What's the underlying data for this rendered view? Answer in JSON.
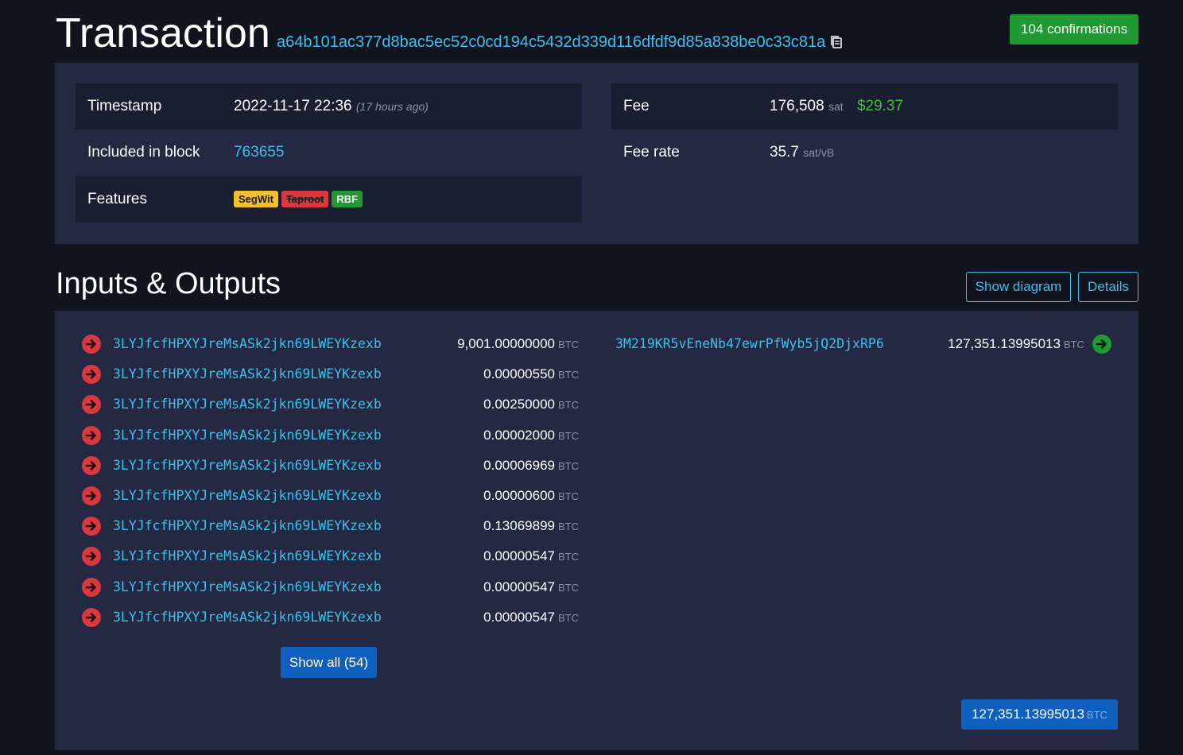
{
  "header": {
    "title": "Transaction",
    "txid": "a64b101ac377d8bac5ec52c0cd194c5432d339d116dfdf9d85a838be0c33c81a",
    "confirmations": "104 confirmations"
  },
  "summary": {
    "timestamp_label": "Timestamp",
    "timestamp_value": "2022-11-17 22:36",
    "timestamp_ago": "(17 hours ago)",
    "block_label": "Included in block",
    "block_value": "763655",
    "features_label": "Features",
    "features": [
      "SegWit",
      "Taproot",
      "RBF"
    ],
    "fee_label": "Fee",
    "fee_value": "176,508",
    "fee_unit": "sat",
    "fee_fiat": "$29.37",
    "feerate_label": "Fee rate",
    "feerate_value": "35.7",
    "feerate_unit": "sat/vB"
  },
  "io": {
    "title": "Inputs & Outputs",
    "show_diagram": "Show diagram",
    "details": "Details",
    "unit": "BTC",
    "inputs": [
      {
        "address": "3LYJfcfHPXYJreMsASk2jkn69LWEYKzexb",
        "amount": "9,001.00000000"
      },
      {
        "address": "3LYJfcfHPXYJreMsASk2jkn69LWEYKzexb",
        "amount": "0.00000550"
      },
      {
        "address": "3LYJfcfHPXYJreMsASk2jkn69LWEYKzexb",
        "amount": "0.00250000"
      },
      {
        "address": "3LYJfcfHPXYJreMsASk2jkn69LWEYKzexb",
        "amount": "0.00002000"
      },
      {
        "address": "3LYJfcfHPXYJreMsASk2jkn69LWEYKzexb",
        "amount": "0.00006969"
      },
      {
        "address": "3LYJfcfHPXYJreMsASk2jkn69LWEYKzexb",
        "amount": "0.00000600"
      },
      {
        "address": "3LYJfcfHPXYJreMsASk2jkn69LWEYKzexb",
        "amount": "0.13069899"
      },
      {
        "address": "3LYJfcfHPXYJreMsASk2jkn69LWEYKzexb",
        "amount": "0.00000547"
      },
      {
        "address": "3LYJfcfHPXYJreMsASk2jkn69LWEYKzexb",
        "amount": "0.00000547"
      },
      {
        "address": "3LYJfcfHPXYJreMsASk2jkn69LWEYKzexb",
        "amount": "0.00000547"
      }
    ],
    "outputs": [
      {
        "address": "3M219KR5vEneNb47ewrPfWyb5jQ2DjxRP6",
        "amount": "127,351.13995013"
      }
    ],
    "show_all": "Show all (54)",
    "total": "127,351.13995013"
  },
  "colors": {
    "background": "#11131f",
    "panel": "#252842",
    "link": "#3cc1eb",
    "success": "#1f9a33",
    "danger": "#d9383f",
    "primary": "#0f5fbe"
  }
}
